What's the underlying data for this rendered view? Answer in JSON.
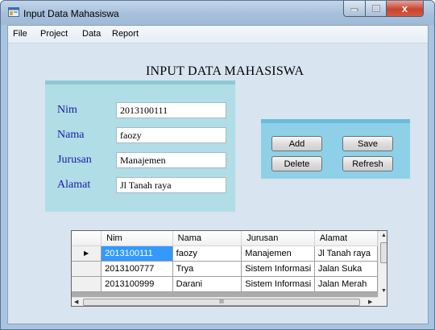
{
  "window": {
    "title": "Input Data Mahasiswa",
    "close_glyph": "x"
  },
  "menu": {
    "items": [
      "File",
      "Project",
      "Data",
      "Report"
    ]
  },
  "form": {
    "heading": "INPUT DATA MAHASISWA",
    "fields": [
      {
        "label": "Nim",
        "value": "2013100111"
      },
      {
        "label": "Nama",
        "value": "faozy"
      },
      {
        "label": "Jurusan",
        "value": "Manajemen"
      },
      {
        "label": "Alamat",
        "value": "Jl Tanah raya"
      }
    ]
  },
  "buttons": {
    "add": "Add",
    "save": "Save",
    "delete": "Delete",
    "refresh": "Refresh"
  },
  "grid": {
    "columns": [
      "Nim",
      "Nama",
      "Jurusan",
      "Alamat"
    ],
    "rows": [
      [
        "2013100111",
        "faozy",
        "Manajemen",
        "Jl Tanah raya"
      ],
      [
        "2013100777",
        "Trya",
        "Sistem Informasi",
        "Jalan Suka"
      ],
      [
        "2013100999",
        "Darani",
        "Sistem Informasi",
        "Jalan Merah"
      ]
    ],
    "current_row_glyph": "▶",
    "hscroll_grip": "III"
  },
  "colors": {
    "selected_cell": "#3399ff",
    "label_text": "#1a1aa8",
    "form_panel": "#b0dde6",
    "button_panel": "#8ed0e8"
  }
}
